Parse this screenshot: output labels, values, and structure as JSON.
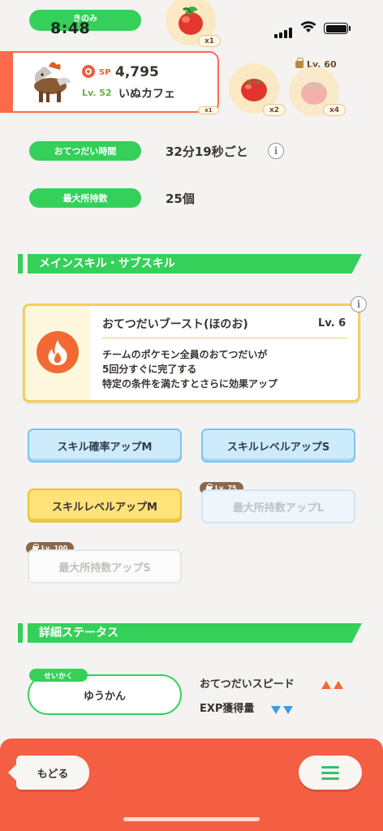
{
  "status_bar": {
    "time": "8:48"
  },
  "top": {
    "kinomi_label": "きのみ",
    "berries": [
      {
        "icon": "apple-berry-icon",
        "count": "x1"
      },
      {
        "icon": "tomato-berry-icon",
        "count": "x2"
      },
      {
        "icon": "tomato-berry-icon",
        "count": "x4",
        "locked_level": "Lv. 60"
      }
    ],
    "hidden_badge": "x1"
  },
  "pokemon": {
    "icon": "entei-icon",
    "sp_label": "SP",
    "sp_value": "4,795",
    "level": "Lv. 52",
    "nickname": "いぬカフェ"
  },
  "help_time": {
    "label": "おてつだい時間",
    "value": "32分19秒ごと"
  },
  "max_carry": {
    "label": "最大所持数",
    "value": "25個"
  },
  "skills_section": {
    "title": "メインスキル・サブスキル"
  },
  "main_skill": {
    "icon": "fire-icon",
    "name": "おてつだいブースト(ほのお)",
    "level": "Lv. 6",
    "desc_lines": [
      "チームのポケモン全員のおてつだいが",
      "5回分すぐに完了する",
      "特定の条件を満たすとさらに効果アップ"
    ]
  },
  "sub_skills": [
    {
      "label": "スキル確率アップM"
    },
    {
      "label": "スキルレベルアップS"
    },
    {
      "label": "スキルレベルアップM"
    },
    {
      "label": "最大所持数アップL",
      "lock": "Lv. 75"
    },
    {
      "label": "最大所持数アップS",
      "lock": "Lv. 100"
    }
  ],
  "detail_section": {
    "title": "詳細ステータス"
  },
  "nature": {
    "tag": "せいかく",
    "value": "ゆうかん"
  },
  "stats": [
    {
      "label": "おてつだいスピード",
      "direction": "up",
      "color": "#f26a33"
    },
    {
      "label": "EXP獲得量",
      "direction": "down",
      "color": "#3a9be8"
    }
  ],
  "footer": {
    "back_label": "もどる",
    "menu_icon": "hamburger-menu-icon"
  }
}
